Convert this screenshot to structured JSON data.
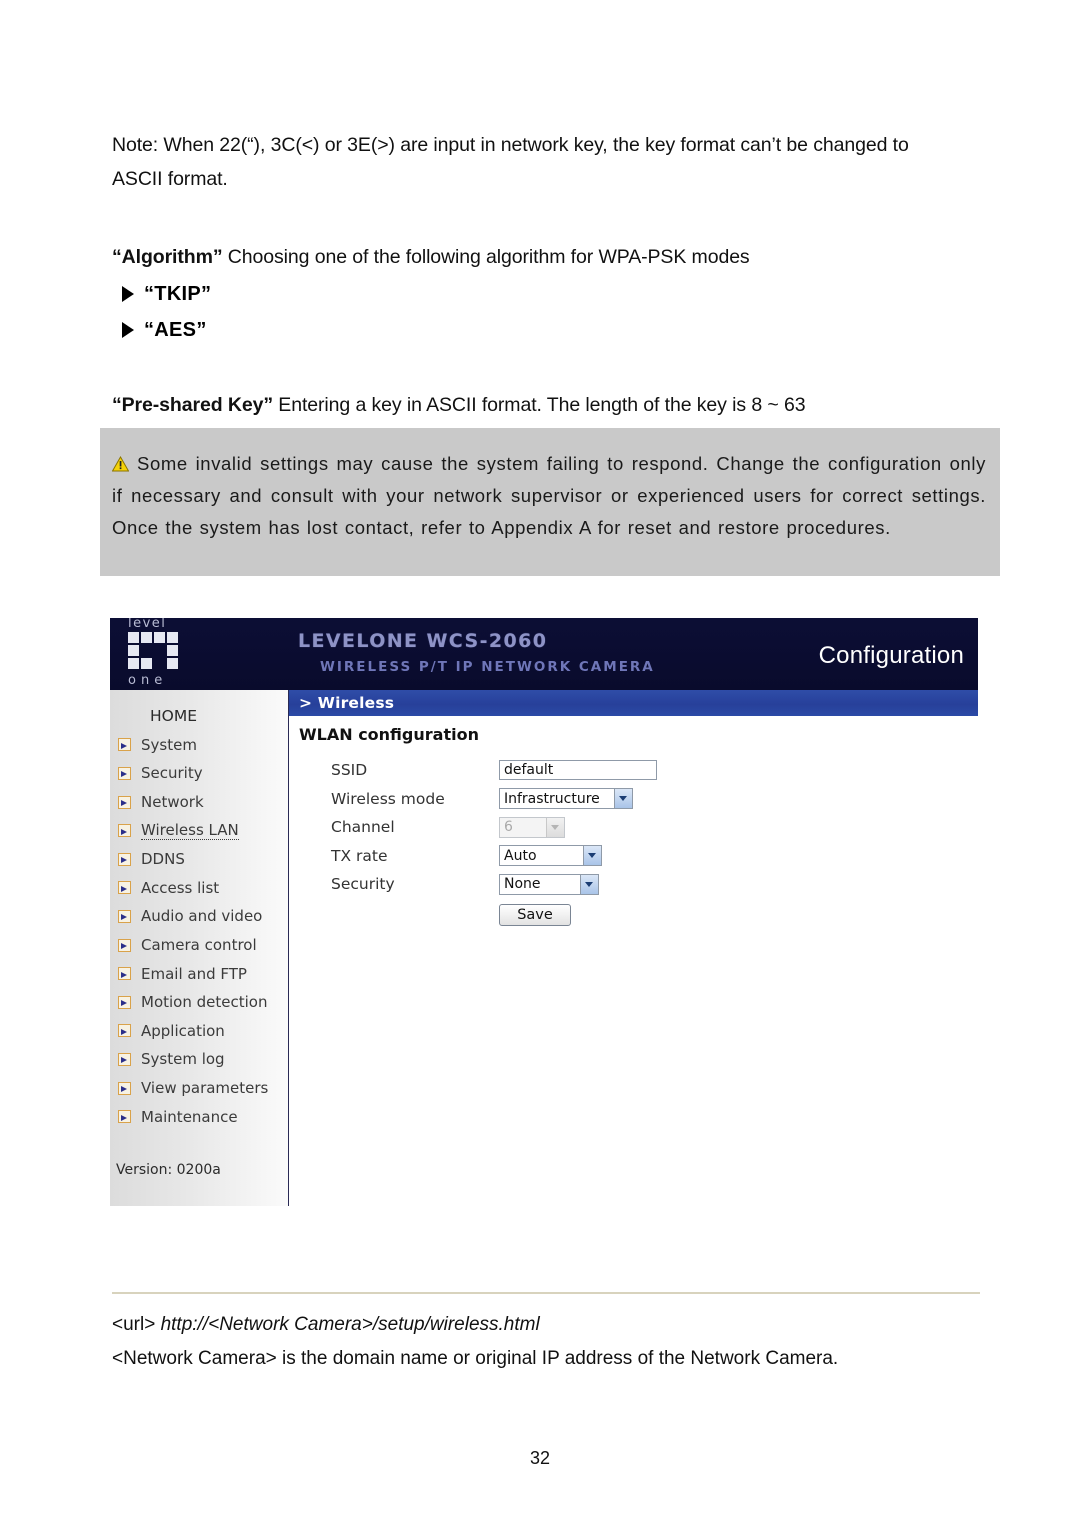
{
  "page": {
    "number": "32"
  },
  "prose": {
    "note": "Note: When 22(“), 3C(<) or 3E(>) are input in network key, the key format can’t be changed to ASCII format.",
    "algorithm_term": "“Algorithm”",
    "algorithm_rest": " Choosing one of the following algorithm for WPA-PSK modes",
    "bullets": [
      {
        "label": "“TKIP”"
      },
      {
        "label": "“AES”"
      }
    ],
    "psk_term": "“Pre-shared Key”",
    "psk_rest": " Entering a key in ASCII format. The length of the key is 8 ~ 63"
  },
  "warning": {
    "icon": "warning-triangle-icon",
    "text": "Some invalid settings may cause the system failing to respond. Change the configuration only if necessary and consult with your network supervisor or experienced users for correct settings. Once the system has lost contact, refer to Appendix A for reset and restore procedures.",
    "background_color": "#c9c9c9"
  },
  "screenshot": {
    "header": {
      "logo_top": "level",
      "logo_bottom": "one",
      "brand_title": "LEVELONE WCS-2060",
      "brand_subtitle": "WIRELESS P/T IP NETWORK CAMERA",
      "right_label": "Configuration",
      "background_color": "#0b0d33"
    },
    "sidebar": {
      "home_label": "HOME",
      "items": [
        {
          "label": "System",
          "active": false
        },
        {
          "label": "Security",
          "active": false
        },
        {
          "label": "Network",
          "active": false
        },
        {
          "label": "Wireless LAN",
          "active": true
        },
        {
          "label": "DDNS",
          "active": false
        },
        {
          "label": "Access list",
          "active": false
        },
        {
          "label": "Audio and video",
          "active": false
        },
        {
          "label": "Camera control",
          "active": false
        },
        {
          "label": "Email and FTP",
          "active": false
        },
        {
          "label": "Motion detection",
          "active": false
        },
        {
          "label": "Application",
          "active": false
        },
        {
          "label": "System log",
          "active": false
        },
        {
          "label": "View parameters",
          "active": false
        },
        {
          "label": "Maintenance",
          "active": false
        }
      ],
      "version": "Version: 0200a"
    },
    "content": {
      "breadcrumb": "> Wireless",
      "breadcrumb_color": "#2b4aa6",
      "section_title": "WLAN configuration",
      "fields": {
        "ssid": {
          "label": "SSID",
          "value": "default"
        },
        "wireless_mode": {
          "label": "Wireless mode",
          "value": "Infrastructure"
        },
        "channel": {
          "label": "Channel",
          "value": "6",
          "disabled": true
        },
        "tx_rate": {
          "label": "TX rate",
          "value": "Auto"
        },
        "security": {
          "label": "Security",
          "value": "None"
        }
      },
      "save_label": "Save"
    }
  },
  "footer": {
    "url_tag": "<url>",
    "url_value": " http://<Network Camera>/setup/wireless.html",
    "note": "<Network Camera> is the domain name or original IP address of the Network Camera."
  }
}
